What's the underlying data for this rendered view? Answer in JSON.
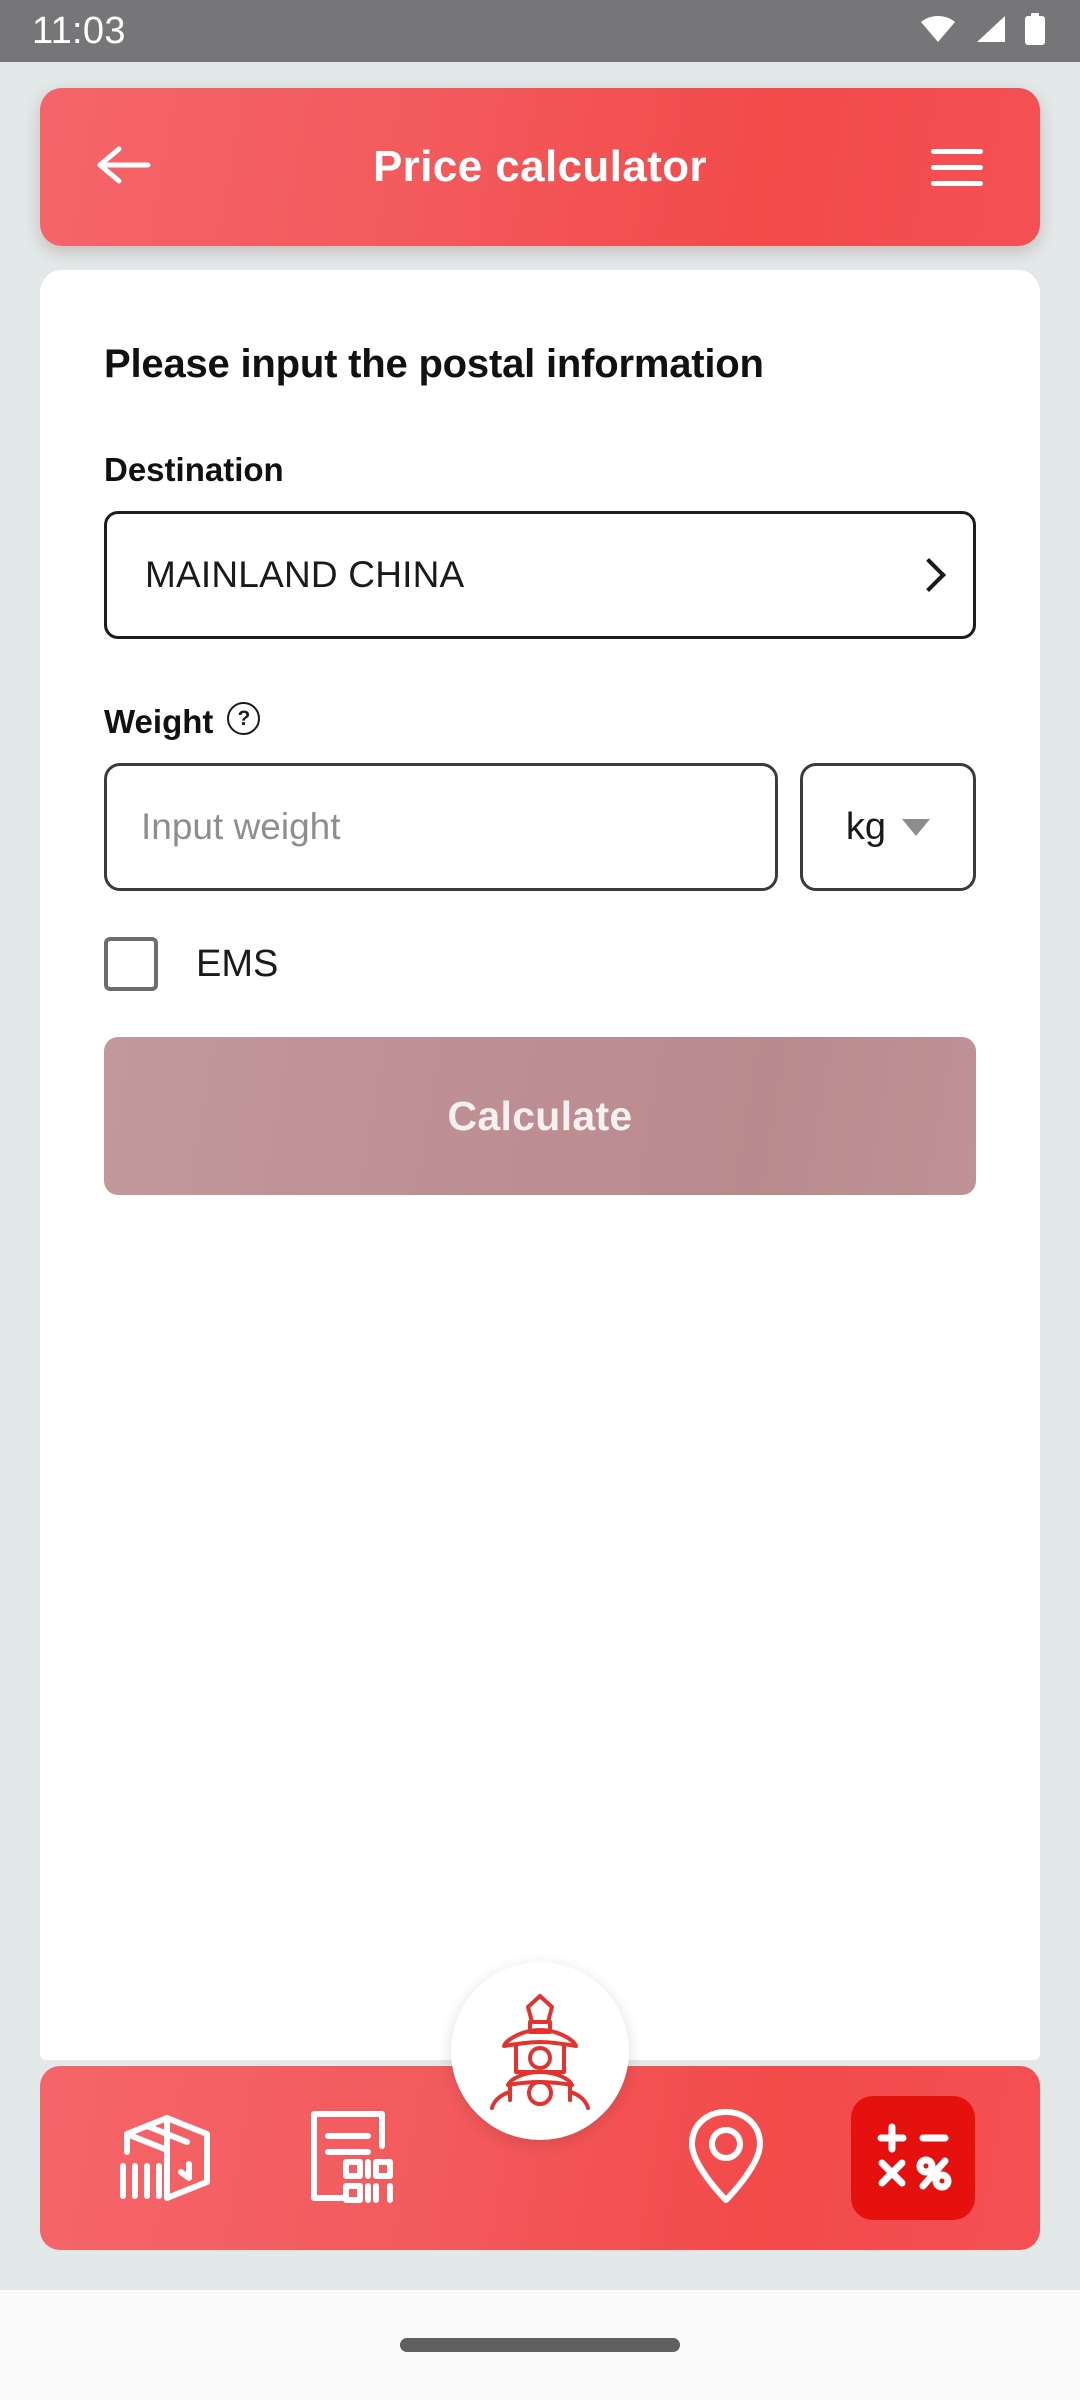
{
  "status_bar": {
    "time": "11:03",
    "icons": [
      "wifi-icon",
      "cellular-signal-icon",
      "battery-icon"
    ]
  },
  "header": {
    "title": "Price calculator",
    "back_icon": "arrow-left-icon",
    "menu_icon": "hamburger-menu-icon",
    "background_color": "#f3504f"
  },
  "form": {
    "heading": "Please input the postal information",
    "destination": {
      "label": "Destination",
      "value": "MAINLAND CHINA",
      "chevron_icon": "chevron-right-icon"
    },
    "weight": {
      "label": "Weight",
      "help_icon": "question-mark-circle-icon",
      "help_glyph": "?",
      "placeholder": "Input weight",
      "value": "",
      "unit": "kg",
      "unit_caret_icon": "caret-down-icon"
    },
    "ems": {
      "label": "EMS",
      "checked": false
    },
    "submit": {
      "label": "Calculate",
      "enabled": false,
      "color": "#bd8f93"
    }
  },
  "bottom_nav": {
    "items": [
      {
        "name": "parcel-tracking",
        "icon": "package-box-barcode-icon",
        "active": false
      },
      {
        "name": "receipt-scan",
        "icon": "document-qr-code-icon",
        "active": false
      },
      {
        "name": "home-logo",
        "icon": "pagoda-tower-logo-icon",
        "active": false
      },
      {
        "name": "post-office-locator",
        "icon": "location-pin-icon",
        "active": false
      },
      {
        "name": "price-calculator",
        "icon": "calculator-operators-icon",
        "active": true
      }
    ],
    "active_tab_color": "#e5110f"
  },
  "system_nav": {
    "gesture_bar": "home-gesture-pill"
  }
}
